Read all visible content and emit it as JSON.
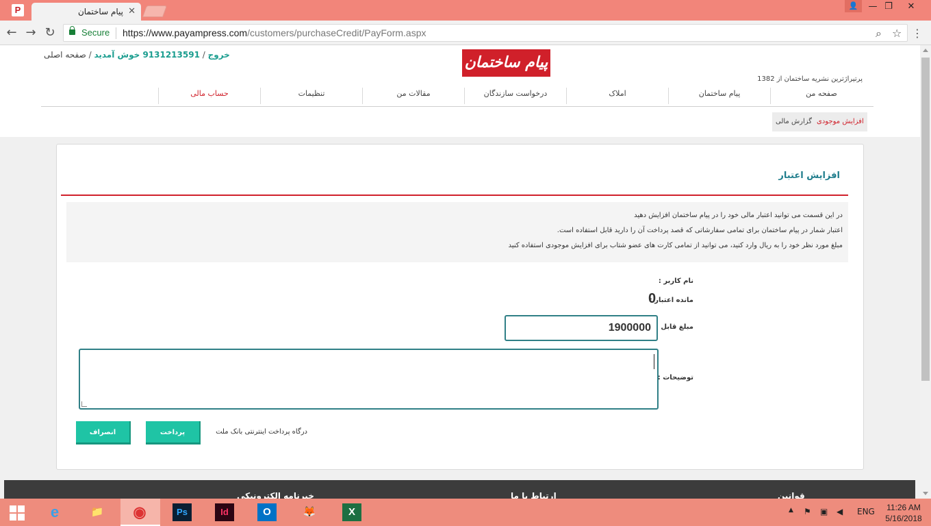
{
  "browser": {
    "tab_title": "پیام ساختمان",
    "tab_close": "✕",
    "secure_label": "Secure",
    "url_host": "https://www.payampress.com",
    "url_path": "/customers/purchaseCredit/PayForm.aspx",
    "win_minimize": "—",
    "win_restore": "❐",
    "win_close": "✕",
    "user_icon": "👤"
  },
  "header": {
    "home_link": "صفحه اصلی",
    "welcome": "9131213591 خوش آمدید",
    "logout": "خروج",
    "sep": " / ",
    "logo_text": "پیام ساختمان",
    "tagline": "پرتیراژترین نشریه ساختمان از 1382"
  },
  "nav": {
    "items": [
      {
        "label": "صفحه من"
      },
      {
        "label": "پیام ساختمان"
      },
      {
        "label": "املاک"
      },
      {
        "label": "درخواست سازندگان"
      },
      {
        "label": "مقالات من"
      },
      {
        "label": "تنظیمات"
      },
      {
        "label": "حساب مالی",
        "active": true
      }
    ]
  },
  "subtabs": {
    "increase": "افزایش موجودی",
    "report": "گزارش مالی"
  },
  "form": {
    "title": "افزایش اعتبار",
    "info_lines": [
      "در این قسمت می توانید اعتبار مالی خود را در پیام ساختمان افزایش دهید",
      "اعتبار شمار در پیام ساختمان برای تمامی سفارشاتی که قصد پرداخت آن را دارید قابل استفاده است.",
      "مبلغ مورد نظر خود را به ریال وارد کنید، می توانید از تمامی کارت های عضو شتاب برای افزایش موجودی استفاده کنید"
    ],
    "username_label": "نام کاربر :",
    "balance_label": "مانده اعتبار :",
    "balance_value": "0",
    "amount_label": "مبلغ قابل پرداخت (ریال) :",
    "amount_value": "1900000",
    "description_label": "توضیحات :",
    "description_value": "",
    "gateway_label": "درگاه پرداخت اینترنتی بانک ملت",
    "pay_button": "پرداخت",
    "cancel_button": "انصراف"
  },
  "footer": {
    "headings": [
      "خبرنامه الکترونیکی",
      "ارتباط با ما",
      "قوانین"
    ]
  },
  "taskbar": {
    "apps": [
      "e",
      "📁",
      "◉",
      "Ps",
      "Id",
      "O",
      "🦊",
      "X"
    ],
    "lang": "ENG",
    "time": "11:26 AM",
    "date": "5/16/2018"
  },
  "colors": {
    "accent_teal": "#1fc4a5",
    "brand_red": "#d0202a",
    "title_teal": "#1f7d8c",
    "tabbar": "#f2857a"
  }
}
